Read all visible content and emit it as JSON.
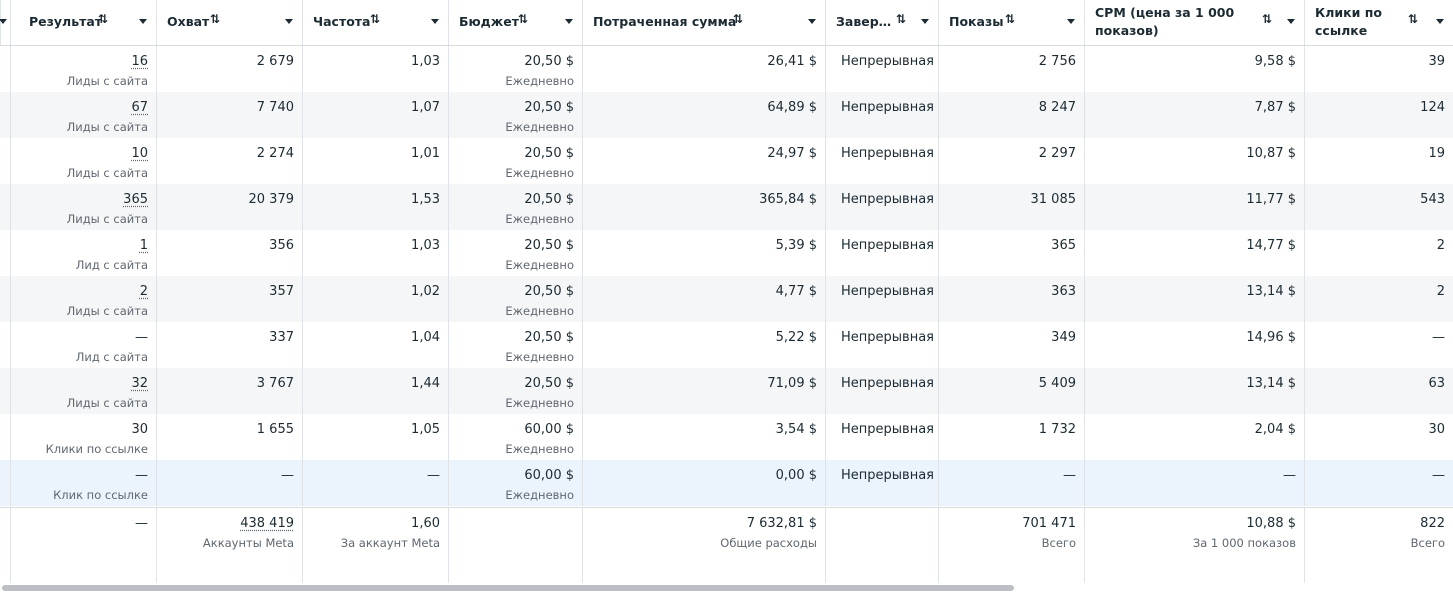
{
  "columns": [
    {
      "label": "Результат",
      "sort_icon": "sort-updown-icon"
    },
    {
      "label": "Охват",
      "sort_icon": "sort-updown-icon"
    },
    {
      "label": "Частота",
      "sort_icon": "sort-updown-icon"
    },
    {
      "label": "Бюджет",
      "sort_icon": "sort-updown-icon"
    },
    {
      "label": "Потраченная сумма",
      "sort_icon": "sort-updown-icon"
    },
    {
      "label": "Завер…",
      "sort_icon": "sort-updown-icon"
    },
    {
      "label": "Показы",
      "sort_icon": "sort-updown-icon"
    },
    {
      "label": "CPM (цена за 1 000 показов)",
      "sort_icon": "sort-updown-icon"
    },
    {
      "label": "Клики по ссылке",
      "sort_icon": "sort-updown-icon"
    }
  ],
  "rows": [
    {
      "result": "16",
      "result_sub": "Лиды с сайта",
      "reach": "2 679",
      "frequency": "1,03",
      "budget": "20,50 $",
      "budget_sub": "Ежедневно",
      "spent": "26,41 $",
      "end": "Непрерывная",
      "impressions": "2 756",
      "cpm": "9,58 $",
      "clicks": "39"
    },
    {
      "result": "67",
      "result_sub": "Лиды с сайта",
      "reach": "7 740",
      "frequency": "1,07",
      "budget": "20,50 $",
      "budget_sub": "Ежедневно",
      "spent": "64,89 $",
      "end": "Непрерывная",
      "impressions": "8 247",
      "cpm": "7,87 $",
      "clicks": "124"
    },
    {
      "result": "10",
      "result_sub": "Лиды с сайта",
      "reach": "2 274",
      "frequency": "1,01",
      "budget": "20,50 $",
      "budget_sub": "Ежедневно",
      "spent": "24,97 $",
      "end": "Непрерывная",
      "impressions": "2 297",
      "cpm": "10,87 $",
      "clicks": "19"
    },
    {
      "result": "365",
      "result_sub": "Лиды с сайта",
      "reach": "20 379",
      "frequency": "1,53",
      "budget": "20,50 $",
      "budget_sub": "Ежедневно",
      "spent": "365,84 $",
      "end": "Непрерывная",
      "impressions": "31 085",
      "cpm": "11,77 $",
      "clicks": "543"
    },
    {
      "result": "1",
      "result_sub": "Лид с сайта",
      "reach": "356",
      "frequency": "1,03",
      "budget": "20,50 $",
      "budget_sub": "Ежедневно",
      "spent": "5,39 $",
      "end": "Непрерывная",
      "impressions": "365",
      "cpm": "14,77 $",
      "clicks": "2"
    },
    {
      "result": "2",
      "result_sub": "Лиды с сайта",
      "reach": "357",
      "frequency": "1,02",
      "budget": "20,50 $",
      "budget_sub": "Ежедневно",
      "spent": "4,77 $",
      "end": "Непрерывная",
      "impressions": "363",
      "cpm": "13,14 $",
      "clicks": "2"
    },
    {
      "result": "—",
      "result_sub": "Лид с сайта",
      "reach": "337",
      "frequency": "1,04",
      "budget": "20,50 $",
      "budget_sub": "Ежедневно",
      "spent": "5,22 $",
      "end": "Непрерывная",
      "impressions": "349",
      "cpm": "14,96 $",
      "clicks": "—"
    },
    {
      "result": "32",
      "result_sub": "Лиды с сайта",
      "reach": "3 767",
      "frequency": "1,44",
      "budget": "20,50 $",
      "budget_sub": "Ежедневно",
      "spent": "71,09 $",
      "end": "Непрерывная",
      "impressions": "5 409",
      "cpm": "13,14 $",
      "clicks": "63"
    },
    {
      "result": "30",
      "result_sub": "Клики по ссылке",
      "reach": "1 655",
      "frequency": "1,05",
      "budget": "60,00 $",
      "budget_sub": "Ежедневно",
      "spent": "3,54 $",
      "end": "Непрерывная",
      "impressions": "1 732",
      "cpm": "2,04 $",
      "clicks": "30"
    },
    {
      "result": "—",
      "result_sub": "Клик по ссылке",
      "reach": "—",
      "frequency": "—",
      "budget": "60,00 $",
      "budget_sub": "Ежедневно",
      "spent": "0,00 $",
      "end": "Непрерывная",
      "impressions": "—",
      "cpm": "—",
      "clicks": "—"
    }
  ],
  "totals": {
    "result": "—",
    "reach": "438 419",
    "reach_sub": "Аккаунты Meta",
    "frequency": "1,60",
    "frequency_sub": "За аккаунт Meta",
    "spent": "7 632,81 $",
    "spent_sub": "Общие расходы",
    "impressions": "701 471",
    "impressions_sub": "Всего",
    "cpm": "10,88 $",
    "cpm_sub": "За 1 000 показов",
    "clicks": "822",
    "clicks_sub": "Всего"
  }
}
